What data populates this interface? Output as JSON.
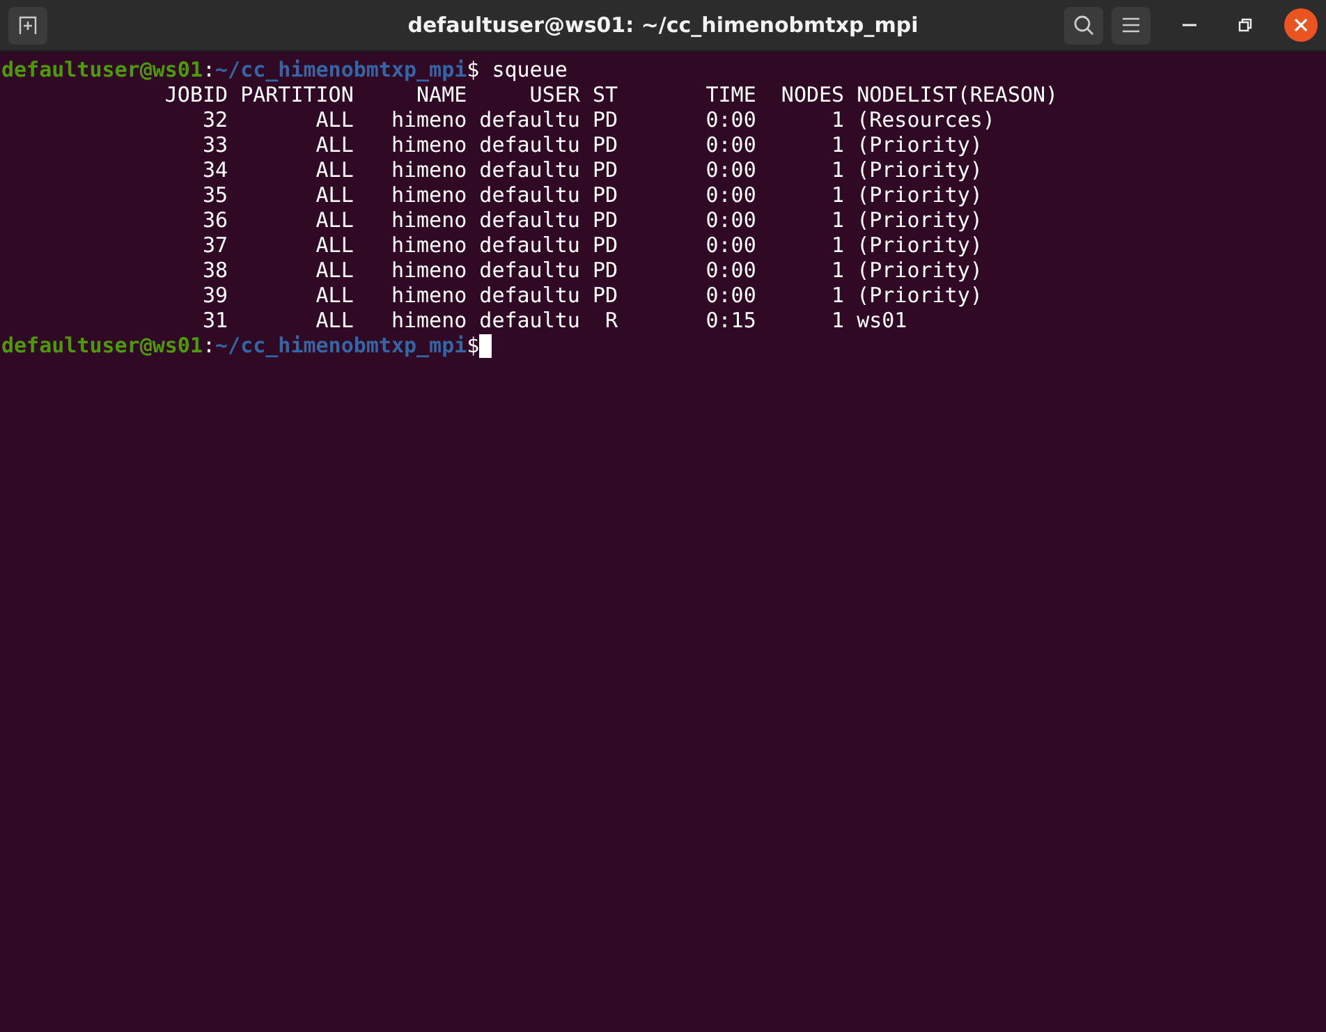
{
  "window": {
    "title": "defaultuser@ws01: ~/cc_himenobmtxp_mpi"
  },
  "terminal": {
    "lines": [
      {
        "kind": "prompt",
        "user_host": "defaultuser@ws01",
        "separator": ":",
        "path": "~/cc_himenobmtxp_mpi",
        "symbol": "$",
        "command": " squeue",
        "cursor": false
      },
      {
        "kind": "output",
        "text": "             JOBID PARTITION     NAME     USER ST       TIME  NODES NODELIST(REASON)"
      },
      {
        "kind": "output",
        "text": "                32       ALL   himeno defaultu PD       0:00      1 (Resources)"
      },
      {
        "kind": "output",
        "text": "                33       ALL   himeno defaultu PD       0:00      1 (Priority)"
      },
      {
        "kind": "output",
        "text": "                34       ALL   himeno defaultu PD       0:00      1 (Priority)"
      },
      {
        "kind": "output",
        "text": "                35       ALL   himeno defaultu PD       0:00      1 (Priority)"
      },
      {
        "kind": "output",
        "text": "                36       ALL   himeno defaultu PD       0:00      1 (Priority)"
      },
      {
        "kind": "output",
        "text": "                37       ALL   himeno defaultu PD       0:00      1 (Priority)"
      },
      {
        "kind": "output",
        "text": "                38       ALL   himeno defaultu PD       0:00      1 (Priority)"
      },
      {
        "kind": "output",
        "text": "                39       ALL   himeno defaultu PD       0:00      1 (Priority)"
      },
      {
        "kind": "output",
        "text": "                31       ALL   himeno defaultu  R       0:15      1 ws01"
      },
      {
        "kind": "prompt",
        "user_host": "defaultuser@ws01",
        "separator": ":",
        "path": "~/cc_himenobmtxp_mpi",
        "symbol": "$",
        "cursor": true
      }
    ]
  }
}
